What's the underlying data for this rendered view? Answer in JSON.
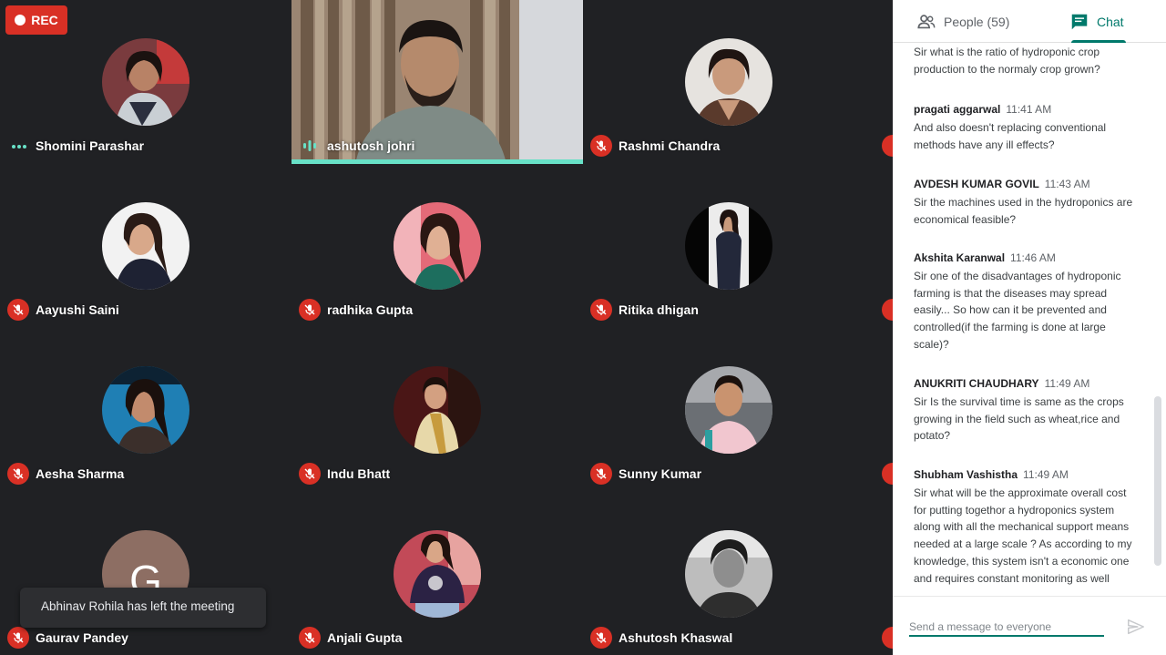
{
  "recording": {
    "label": "REC",
    "color": "#d93025"
  },
  "speaker": {
    "name": "ashutosh johri",
    "active_color": "#68e1c7"
  },
  "participants": [
    {
      "name": "Shomini Parashar",
      "status": "more",
      "avatar": "photo"
    },
    {
      "name": "Rashmi Chandra",
      "status": "muted",
      "avatar": "photo"
    },
    {
      "name": "Aayushi Saini",
      "status": "muted",
      "avatar": "photo"
    },
    {
      "name": "radhika Gupta",
      "status": "muted",
      "avatar": "photo"
    },
    {
      "name": "Ritika dhigan",
      "status": "muted",
      "avatar": "photo"
    },
    {
      "name": "Aesha Sharma",
      "status": "muted",
      "avatar": "photo"
    },
    {
      "name": "Indu Bhatt",
      "status": "muted",
      "avatar": "photo"
    },
    {
      "name": "Sunny Kumar",
      "status": "muted",
      "avatar": "photo"
    },
    {
      "name": "Gaurav Pandey",
      "status": "muted",
      "avatar": "letter",
      "initial": "G"
    },
    {
      "name": "Anjali Gupta",
      "status": "muted",
      "avatar": "photo"
    },
    {
      "name": "Ashutosh Khaswal",
      "status": "muted",
      "avatar": "photo"
    }
  ],
  "toast": "Abhinav Rohila has left the meeting",
  "panel": {
    "tabs": {
      "people": "People (59)",
      "chat": "Chat"
    },
    "messages": [
      {
        "sender": "",
        "time": "",
        "text": "Sir what is the ratio of hydroponic crop production to the normaly crop grown?"
      },
      {
        "sender": "pragati aggarwal",
        "time": "11:41 AM",
        "text": "And also doesn't replacing conventional methods  have any ill effects?"
      },
      {
        "sender": "AVDESH KUMAR GOVIL",
        "time": "11:43 AM",
        "text": "Sir the machines used in the hydroponics are economical feasible?"
      },
      {
        "sender": "Akshita Karanwal",
        "time": "11:46 AM",
        "text": "Sir one of the disadvantages of hydroponic farming is that the diseases may spread easily... So how can it be prevented and controlled(if the farming is done at large scale)?"
      },
      {
        "sender": "ANUKRITI CHAUDHARY",
        "time": "11:49 AM",
        "text": "Sir Is the survival time is same as the crops growing in the field such as wheat,rice and potato?"
      },
      {
        "sender": "Shubham Vashistha",
        "time": "11:49 AM",
        "text": "Sir what will be the approximate  overall cost for putting togethor a hydroponics system along with all the mechanical support means needed at a  large scale ? As according to my knowledge, this  system isn't a economic one and requires constant monitoring as well"
      }
    ],
    "composer_placeholder": "Send a message to everyone"
  }
}
